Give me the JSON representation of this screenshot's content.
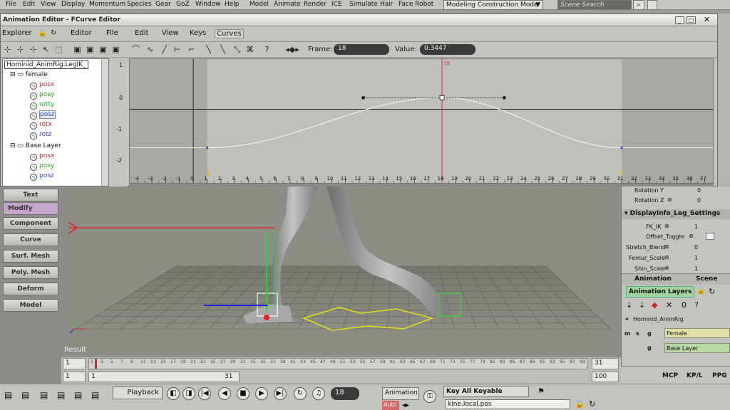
{
  "menubar": {
    "items": [
      "File",
      "Edit",
      "View",
      "Display",
      "Momentum",
      "Species",
      "Gear",
      "GoZ",
      "Window",
      "Help",
      "Model",
      "Animate",
      "Render",
      "ICE",
      "Simulate",
      "Hair",
      "Face Robot"
    ],
    "mode_combo": "Modeling Construction Mode",
    "search_placeholder": "Scene Search"
  },
  "fcurve_editor": {
    "title": "Animation Editor - FCurve Editor",
    "menu": {
      "explorer": "Explorer",
      "editor": "Editor",
      "file": "File",
      "edit": "Edit",
      "view": "View",
      "keys": "Keys",
      "curves": "Curves"
    },
    "frame_label": "Frame:",
    "frame_value": "18",
    "value_label": "Value:",
    "value_value": "0.3447",
    "tree": {
      "root": "Hominid_AnimRig.LegIK_",
      "group1": "female",
      "group1_items": [
        "posx",
        "posy",
        "rotty",
        "posz",
        "rotx",
        "rotz"
      ],
      "group2": "Base Layer",
      "group2_items": [
        "posx",
        "posy",
        "posz"
      ]
    },
    "graph": {
      "y_ticks": [
        "1",
        "0",
        "-1",
        "-2"
      ],
      "x_ticks": [
        "-4",
        "-3",
        "-2",
        "-1",
        "0",
        "1",
        "2",
        "3",
        "4",
        "5",
        "6",
        "7",
        "8",
        "9",
        "10",
        "11",
        "12",
        "13",
        "14",
        "15",
        "16",
        "17",
        "18",
        "19",
        "20",
        "21",
        "22",
        "23",
        "24",
        "25",
        "26",
        "27",
        "28",
        "29",
        "30",
        "31",
        "32",
        "33",
        "34",
        "35",
        "36",
        "37"
      ],
      "current_frame_label": "18",
      "curve": {
        "keys": [
          {
            "frame": 1,
            "value": -1.15
          },
          {
            "frame": 18,
            "value": 0.3447
          },
          {
            "frame": 31,
            "value": -1.15
          }
        ]
      }
    }
  },
  "left_panel": {
    "buttons": [
      "Text",
      "Modify",
      "Component",
      "Curve",
      "Surf. Mesh",
      "Poly. Mesh",
      "Deform",
      "Model"
    ]
  },
  "viewport": {
    "label": "Result"
  },
  "right_panel": {
    "rotation_y_label": "Rotation Y",
    "rotation_y_value": "0",
    "rotation_z_label": "Rotation Z",
    "rotation_z_value": "0",
    "section": "DisplayInfo_Leg_Settings",
    "params": [
      {
        "label": "FK_IK",
        "value": "1"
      },
      {
        "label": "Offset_Toggle",
        "value": ""
      },
      {
        "label": "Stretch_Blend",
        "value": "0"
      },
      {
        "label": "Femur_Scale",
        "value": "1"
      },
      {
        "label": "Shin_Scale",
        "value": "1"
      }
    ],
    "tabs": [
      "Animation",
      "Scene"
    ],
    "anim_layers_label": "Animation Layers",
    "rig_name": "Hominid_AnimRig",
    "layer_flags": [
      "m",
      "s",
      "g"
    ],
    "layers": [
      "Female",
      "Base Layer"
    ],
    "bottom_tabs": [
      "MCP",
      "KP/L",
      "PPG"
    ]
  },
  "timeline": {
    "start": "1",
    "ticks": [
      "1",
      "3",
      "5",
      "7",
      "9",
      "11",
      "13",
      "15",
      "17",
      "19",
      "21",
      "23",
      "25",
      "27",
      "29",
      "31",
      "33",
      "35",
      "37",
      "39",
      "41",
      "43",
      "45",
      "47",
      "49",
      "51",
      "53",
      "55",
      "57",
      "59",
      "61",
      "63",
      "65",
      "67",
      "69",
      "71",
      "73",
      "75",
      "77",
      "79",
      "81",
      "83",
      "85",
      "87",
      "89",
      "91",
      "93",
      "95",
      "97",
      "99"
    ],
    "end_label": "31",
    "range_start": "1",
    "range_inner": "1",
    "range_end": "31",
    "range_max": "100"
  },
  "bottom_bar": {
    "playback": "Playback",
    "current_frame": "18",
    "animation_label": "Animation",
    "auto_label": "Auto",
    "key_label": "Key All Keyable",
    "status_field": "kine.local.pos"
  }
}
